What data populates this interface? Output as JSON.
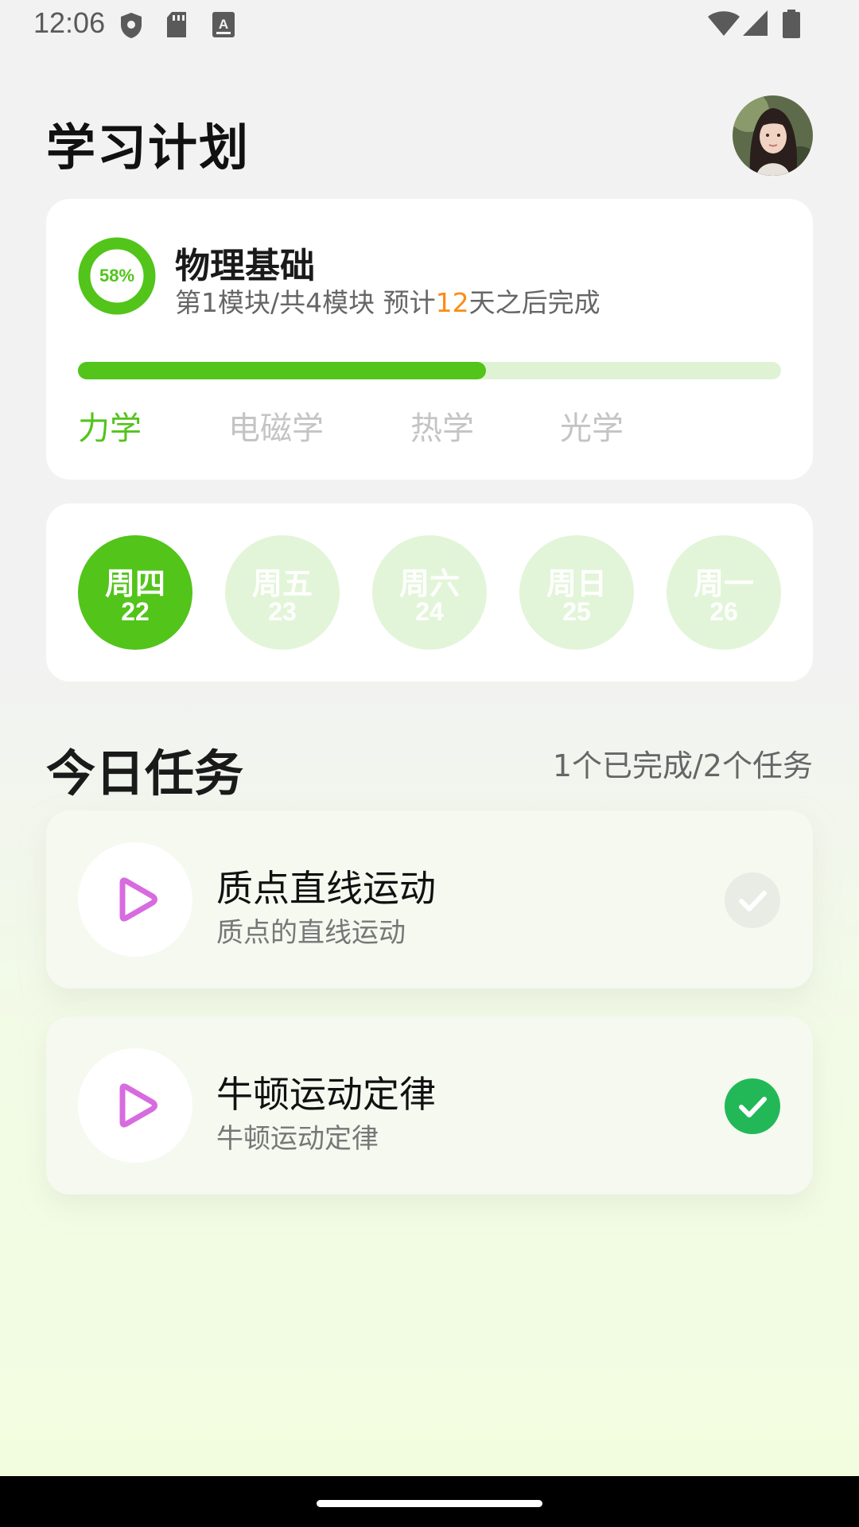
{
  "status_bar": {
    "time": "12:06",
    "left_icons": [
      "shield-icon",
      "sd-card-icon",
      "keyboard-a-icon"
    ],
    "right_icons": [
      "wifi-icon",
      "signal-icon",
      "battery-icon"
    ]
  },
  "header": {
    "title": "学习计划",
    "avatar": "user-avatar"
  },
  "course": {
    "progress_label": "58%",
    "progress_fraction": 0.58,
    "title": "物理基础",
    "meta_prefix": "第1模块/共4模块  预计",
    "meta_days": "12",
    "meta_suffix": "天之后完成",
    "module_progress_fraction": 0.58,
    "modules": [
      {
        "label": "力学",
        "active": true
      },
      {
        "label": "电磁学",
        "active": false
      },
      {
        "label": "热学",
        "active": false
      },
      {
        "label": "光学",
        "active": false
      }
    ]
  },
  "week": {
    "days": [
      {
        "name": "周四",
        "date": "22",
        "active": true
      },
      {
        "name": "周五",
        "date": "23",
        "active": false
      },
      {
        "name": "周六",
        "date": "24",
        "active": false
      },
      {
        "name": "周日",
        "date": "25",
        "active": false
      },
      {
        "name": "周一",
        "date": "26",
        "active": false
      }
    ]
  },
  "tasks": {
    "title": "今日任务",
    "count": "1个已完成/2个任务",
    "items": [
      {
        "title": "质点直线运动",
        "subtitle": "质点的直线运动",
        "done": false,
        "icon": "play-icon"
      },
      {
        "title": "牛顿运动定律",
        "subtitle": "牛顿运动定律",
        "done": true,
        "icon": "play-icon"
      }
    ]
  },
  "colors": {
    "accent": "#52c41a",
    "accent_light": "#e2f5d8",
    "highlight": "#fa8c16",
    "done": "#22b857",
    "play_icon": "#d86be0"
  }
}
